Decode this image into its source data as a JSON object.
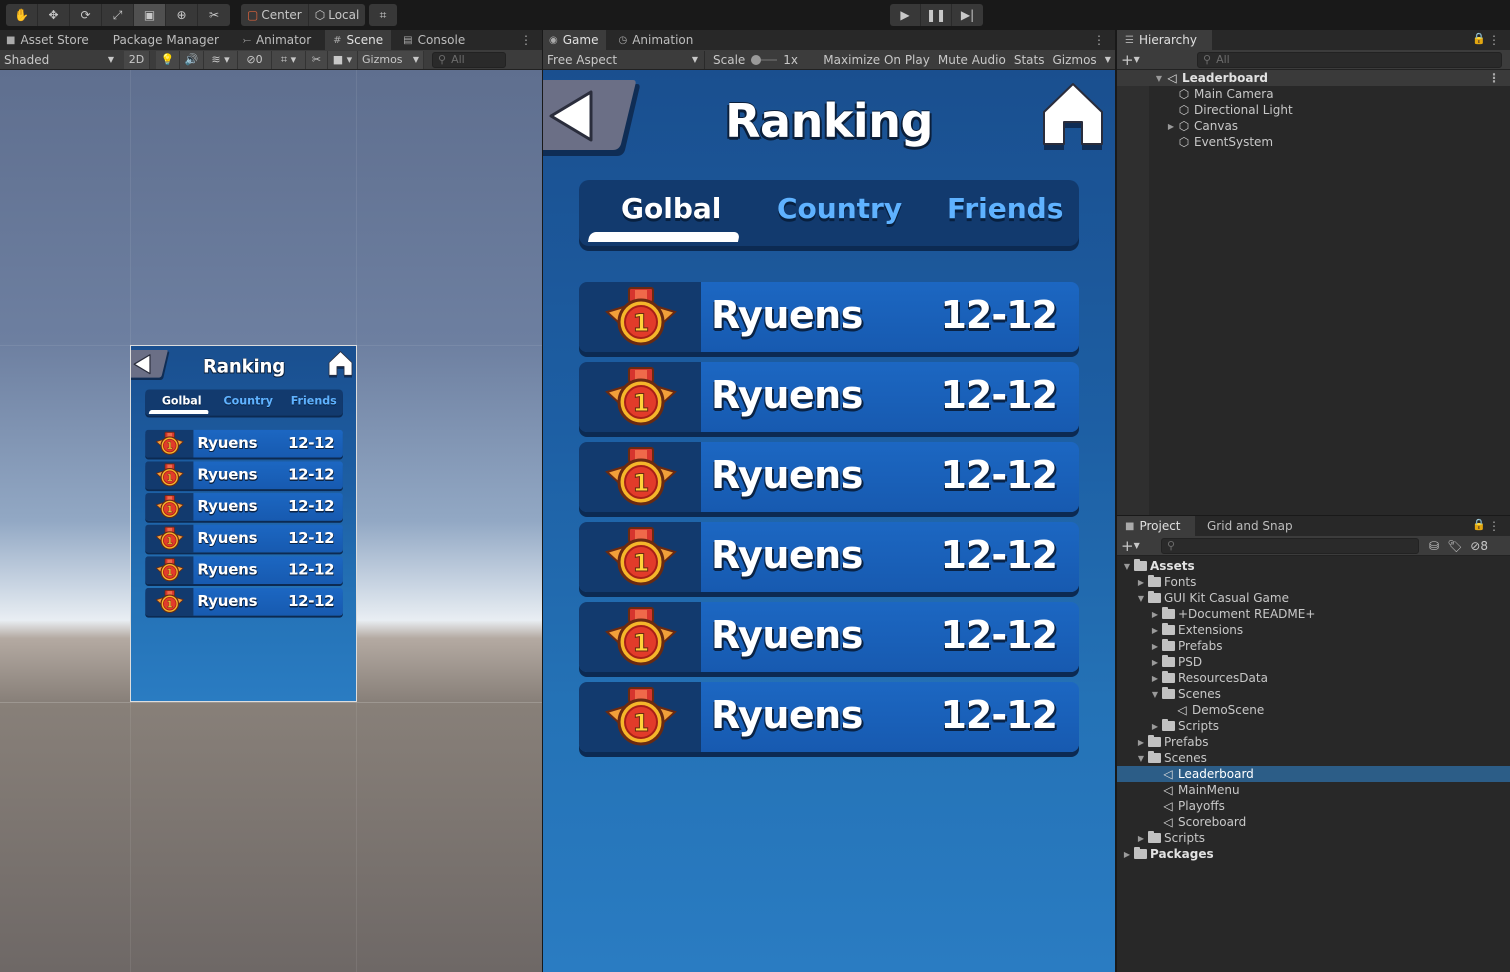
{
  "toolbar": {
    "tools": [
      "hand-icon",
      "move-icon",
      "rotate-icon",
      "scale-icon",
      "rect-icon",
      "transform-icon",
      "custom-tool-icon"
    ],
    "pivot_mode": "Center",
    "pivot_rotation": "Local"
  },
  "scene_panel": {
    "tabs": [
      "Asset Store",
      "Package Manager",
      "Animator",
      "Scene",
      "Console"
    ],
    "active_tab": "Scene",
    "shading_mode": "Shaded",
    "mode_2d": "2D",
    "hidden_count": "0",
    "gizmos_label": "Gizmos",
    "search_placeholder": "All"
  },
  "game_panel": {
    "tabs": [
      "Game",
      "Animation"
    ],
    "active_tab": "Game",
    "aspect": "Free Aspect",
    "scale_label": "Scale",
    "scale_value": "1x",
    "buttons": [
      "Maximize On Play",
      "Mute Audio",
      "Stats",
      "Gizmos"
    ]
  },
  "leaderboard": {
    "title": "Ranking",
    "tabs": [
      "Golbal",
      "Country",
      "Friends"
    ],
    "active_tab_index": 0,
    "rank_badge": "1",
    "rows": [
      {
        "name": "Ryuens",
        "score": "12-12"
      },
      {
        "name": "Ryuens",
        "score": "12-12"
      },
      {
        "name": "Ryuens",
        "score": "12-12"
      },
      {
        "name": "Ryuens",
        "score": "12-12"
      },
      {
        "name": "Ryuens",
        "score": "12-12"
      },
      {
        "name": "Ryuens",
        "score": "12-12"
      }
    ]
  },
  "hierarchy": {
    "tab": "Hierarchy",
    "search_placeholder": "All",
    "scene": "Leaderboard",
    "items": [
      "Main Camera",
      "Directional Light",
      "Canvas",
      "EventSystem"
    ]
  },
  "project": {
    "tabs": [
      "Project",
      "Grid and Snap"
    ],
    "active_tab": "Project",
    "hidden_count": "8",
    "tree": [
      {
        "label": "Assets",
        "level": 0,
        "type": "folder",
        "open": true,
        "bold": true
      },
      {
        "label": "Fonts",
        "level": 1,
        "type": "folder",
        "open": false
      },
      {
        "label": "GUI Kit Casual Game",
        "level": 1,
        "type": "folder",
        "open": true
      },
      {
        "label": "+Document README+",
        "level": 2,
        "type": "folder",
        "open": false
      },
      {
        "label": "Extensions",
        "level": 2,
        "type": "folder",
        "open": false
      },
      {
        "label": "Prefabs",
        "level": 2,
        "type": "folder",
        "open": false
      },
      {
        "label": "PSD",
        "level": 2,
        "type": "folder",
        "open": false
      },
      {
        "label": "ResourcesData",
        "level": 2,
        "type": "folder",
        "open": false
      },
      {
        "label": "Scenes",
        "level": 2,
        "type": "folder",
        "open": true
      },
      {
        "label": "DemoScene",
        "level": 3,
        "type": "scene"
      },
      {
        "label": "Scripts",
        "level": 2,
        "type": "folder",
        "open": false
      },
      {
        "label": "Prefabs",
        "level": 1,
        "type": "folder",
        "open": false
      },
      {
        "label": "Scenes",
        "level": 1,
        "type": "folder",
        "open": true
      },
      {
        "label": "Leaderboard",
        "level": 2,
        "type": "scene",
        "selected": true
      },
      {
        "label": "MainMenu",
        "level": 2,
        "type": "scene"
      },
      {
        "label": "Playoffs",
        "level": 2,
        "type": "scene"
      },
      {
        "label": "Scoreboard",
        "level": 2,
        "type": "scene"
      },
      {
        "label": "Scripts",
        "level": 1,
        "type": "folder",
        "open": false
      },
      {
        "label": "Packages",
        "level": 0,
        "type": "folder",
        "open": false,
        "bold": true
      }
    ]
  }
}
